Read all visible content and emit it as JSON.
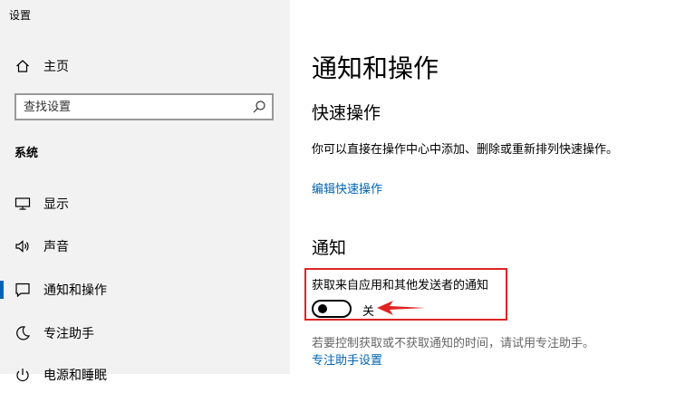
{
  "window": {
    "title": "设置"
  },
  "sidebar": {
    "home_label": "主页",
    "search_placeholder": "查找设置",
    "section_label": "系统",
    "items": [
      {
        "label": "显示",
        "icon": "monitor-icon"
      },
      {
        "label": "声音",
        "icon": "speaker-icon"
      },
      {
        "label": "通知和操作",
        "icon": "notification-icon",
        "active": true
      },
      {
        "label": "专注助手",
        "icon": "moon-icon"
      },
      {
        "label": "电源和睡眠",
        "icon": "power-icon"
      }
    ]
  },
  "main": {
    "title": "通知和操作",
    "quick_actions": {
      "heading": "快速操作",
      "description": "你可以直接在操作中心中添加、删除或重新排列快速操作。",
      "edit_link": "编辑快速操作"
    },
    "notifications": {
      "heading": "通知",
      "setting_label": "获取来自应用和其他发送者的通知",
      "toggle_state": "关",
      "toggle_on": false,
      "focus_hint": "若要控制获取或不获取通知的时间，请试用专注助手。",
      "focus_link": "专注助手设置"
    }
  },
  "colors": {
    "accent": "#0063b1",
    "highlight": "#e02424",
    "sidebar_bg": "#f2f2f2"
  }
}
